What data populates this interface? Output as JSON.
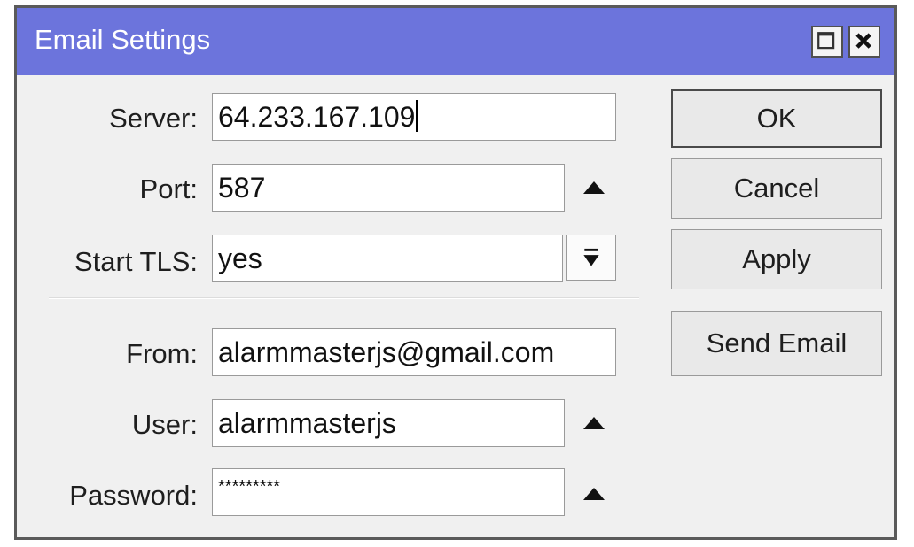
{
  "window": {
    "title": "Email Settings"
  },
  "form": {
    "server": {
      "label": "Server:",
      "value": "64.233.167.109"
    },
    "port": {
      "label": "Port:",
      "value": "587"
    },
    "start_tls": {
      "label": "Start TLS:",
      "value": "yes"
    },
    "from": {
      "label": "From:",
      "value": "alarmmasterjs@gmail.com"
    },
    "user": {
      "label": "User:",
      "value": "alarmmasterjs"
    },
    "password": {
      "label": "Password:",
      "value": "*********"
    }
  },
  "buttons": {
    "ok": "OK",
    "cancel": "Cancel",
    "apply": "Apply",
    "send_email": "Send Email"
  },
  "icons": {
    "maximize": "maximize-icon",
    "close": "close-icon",
    "arrow_up": "arrow-up-icon",
    "dropdown": "dropdown-arrow-icon"
  },
  "colors": {
    "titlebar": "#6c74dc",
    "window_bg": "#f0f0f0",
    "field_bg": "#ffffff",
    "button_bg": "#e9e9e9"
  }
}
